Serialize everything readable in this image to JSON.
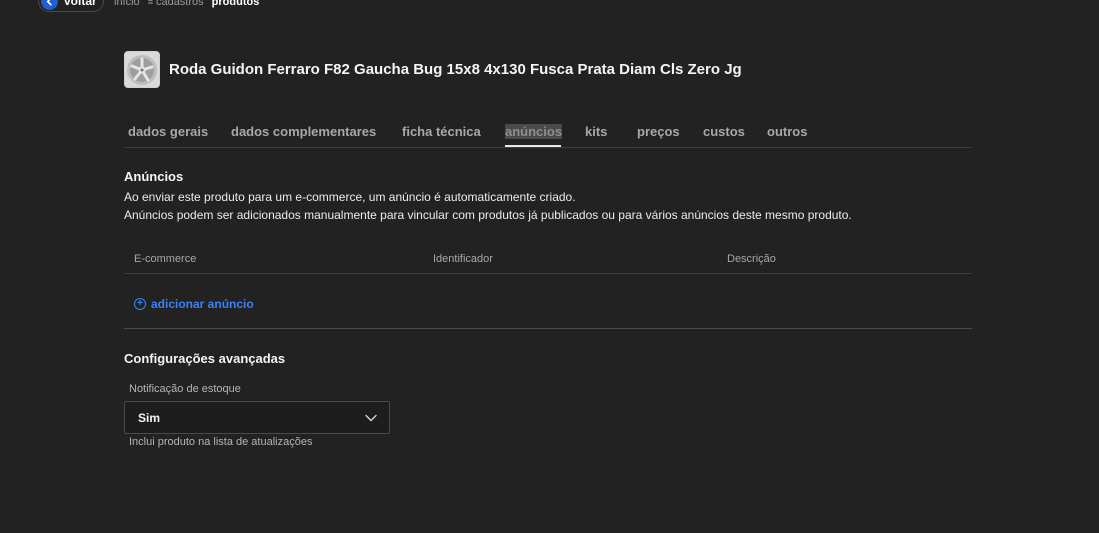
{
  "topbar": {
    "back_label": "voltar",
    "breadcrumb": [
      "início",
      "cadastros",
      "produtos"
    ]
  },
  "product": {
    "title": "Roda Guidon Ferraro F82 Gaucha Bug 15x8 4x130 Fusca Prata Diam Cls Zero Jg"
  },
  "tabs": [
    {
      "label": "dados gerais"
    },
    {
      "label": "dados complementares"
    },
    {
      "label": "ficha técnica"
    },
    {
      "label": "anúncios",
      "active": true
    },
    {
      "label": "kits"
    },
    {
      "label": "preços"
    },
    {
      "label": "custos"
    },
    {
      "label": "outros"
    }
  ],
  "anuncios": {
    "title": "Anúncios",
    "description_1": "Ao enviar este produto para um e-commerce, um anúncio é automaticamente criado.",
    "description_2": "Anúncios podem ser adicionados manualmente para vincular com produtos já publicados ou para vários anúncios deste mesmo produto.",
    "columns": [
      "E-commerce",
      "Identificador",
      "Descrição"
    ],
    "add_label": "adicionar anúncio"
  },
  "advanced": {
    "title": "Configurações avançadas",
    "stock_notification_label": "Notificação de estoque",
    "stock_notification_value": "Sim",
    "stock_notification_hint": "Inclui produto na lista de atualizações"
  },
  "colors": {
    "background": "#222222",
    "accent": "#3b82f6",
    "back_button": "#1f5fd6"
  }
}
